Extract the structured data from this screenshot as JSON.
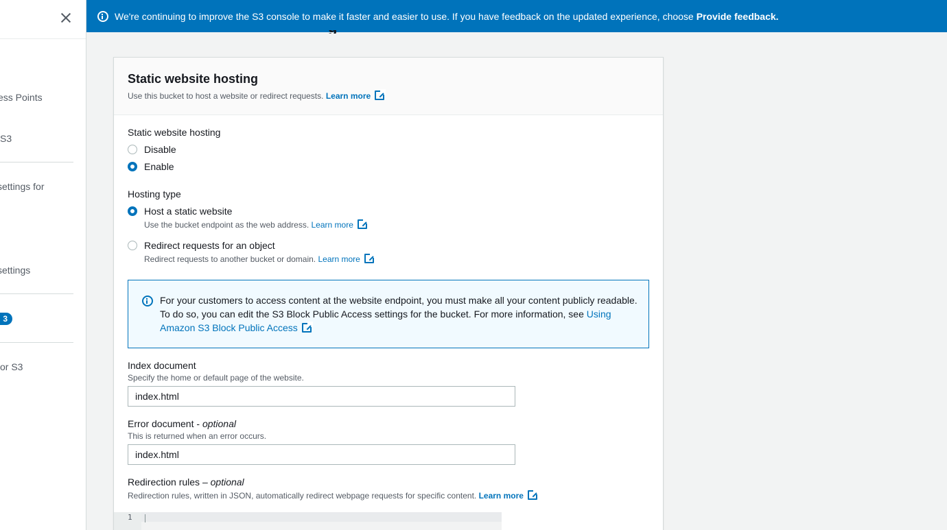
{
  "sidebar": {
    "items": [
      {
        "label": "ess Points"
      },
      {
        "label": "S3"
      },
      {
        "label": " settings for"
      },
      {
        "label": " settings"
      },
      {
        "label": "or S3"
      }
    ],
    "badge": "3"
  },
  "flash": {
    "message": "We're continuing to improve the S3 console to make it faster and easier to use. If you have feedback on the updated experience, choose",
    "link": "Provide feedback."
  },
  "section": {
    "title": "Static website hosting",
    "description": "Use this bucket to host a website or redirect requests.",
    "learn_more": "Learn more"
  },
  "hosting": {
    "label": "Static website hosting",
    "options": [
      {
        "label": "Disable",
        "selected": false
      },
      {
        "label": "Enable",
        "selected": true
      }
    ]
  },
  "hosting_type": {
    "label": "Hosting type",
    "options": [
      {
        "label": "Host a static website",
        "description": "Use the bucket endpoint as the web address.",
        "learn_more": "Learn more",
        "selected": true
      },
      {
        "label": "Redirect requests for an object",
        "description": "Redirect requests to another bucket or domain.",
        "learn_more": "Learn more",
        "selected": false
      }
    ]
  },
  "alert": {
    "text": "For your customers to access content at the website endpoint, you must make all your content publicly readable. To do so, you can edit the S3 Block Public Access settings for the bucket. For more information, see",
    "link": "Using Amazon S3 Block Public Access"
  },
  "index_document": {
    "label": "Index document",
    "description": "Specify the home or default page of the website.",
    "value": "index.html"
  },
  "error_document": {
    "label": "Error document - ",
    "label_optional": "optional",
    "description": "This is returned when an error occurs.",
    "value": "index.html"
  },
  "redirection_rules": {
    "label": "Redirection rules – ",
    "label_optional": "optional",
    "description": "Redirection rules, written in JSON, automatically redirect webpage requests for specific content.",
    "learn_more": "Learn more",
    "line_number": "1"
  },
  "colors": {
    "primary": "#0073bb",
    "alert_bg": "#f1faff",
    "page_bg": "#f2f3f3"
  }
}
